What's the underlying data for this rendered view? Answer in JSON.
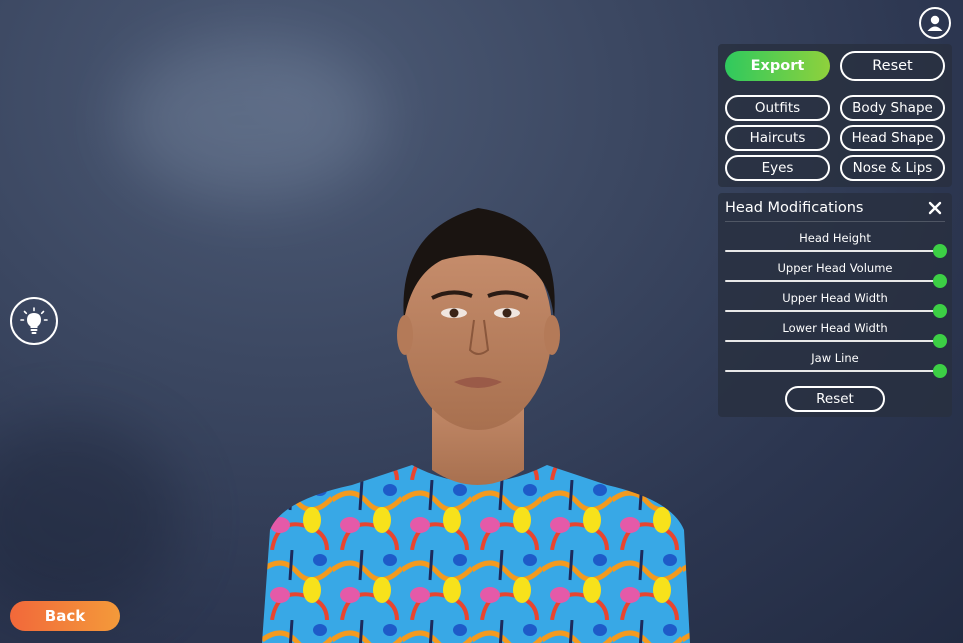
{
  "toolbar": {
    "export_label": "Export",
    "reset_label": "Reset"
  },
  "categories": [
    {
      "label": "Outfits"
    },
    {
      "label": "Body Shape"
    },
    {
      "label": "Haircuts"
    },
    {
      "label": "Head Shape"
    },
    {
      "label": "Eyes"
    },
    {
      "label": "Nose & Lips"
    }
  ],
  "head_modifications": {
    "title": "Head Modifications",
    "close_icon": "close-icon",
    "sliders": [
      {
        "label": "Head Height",
        "value": 1.0
      },
      {
        "label": "Upper Head Volume",
        "value": 1.0
      },
      {
        "label": "Upper Head Width",
        "value": 1.0
      },
      {
        "label": "Lower Head Width",
        "value": 1.0
      },
      {
        "label": "Jaw Line",
        "value": 1.0
      }
    ],
    "reset_label": "Reset"
  },
  "icons": {
    "user": "user-icon",
    "hint": "lightbulb-icon"
  },
  "back_label": "Back",
  "colors": {
    "export": "#3ccf45",
    "back": "#f2683a",
    "slider_thumb": "#3ccf45",
    "background": "#3c4862"
  }
}
